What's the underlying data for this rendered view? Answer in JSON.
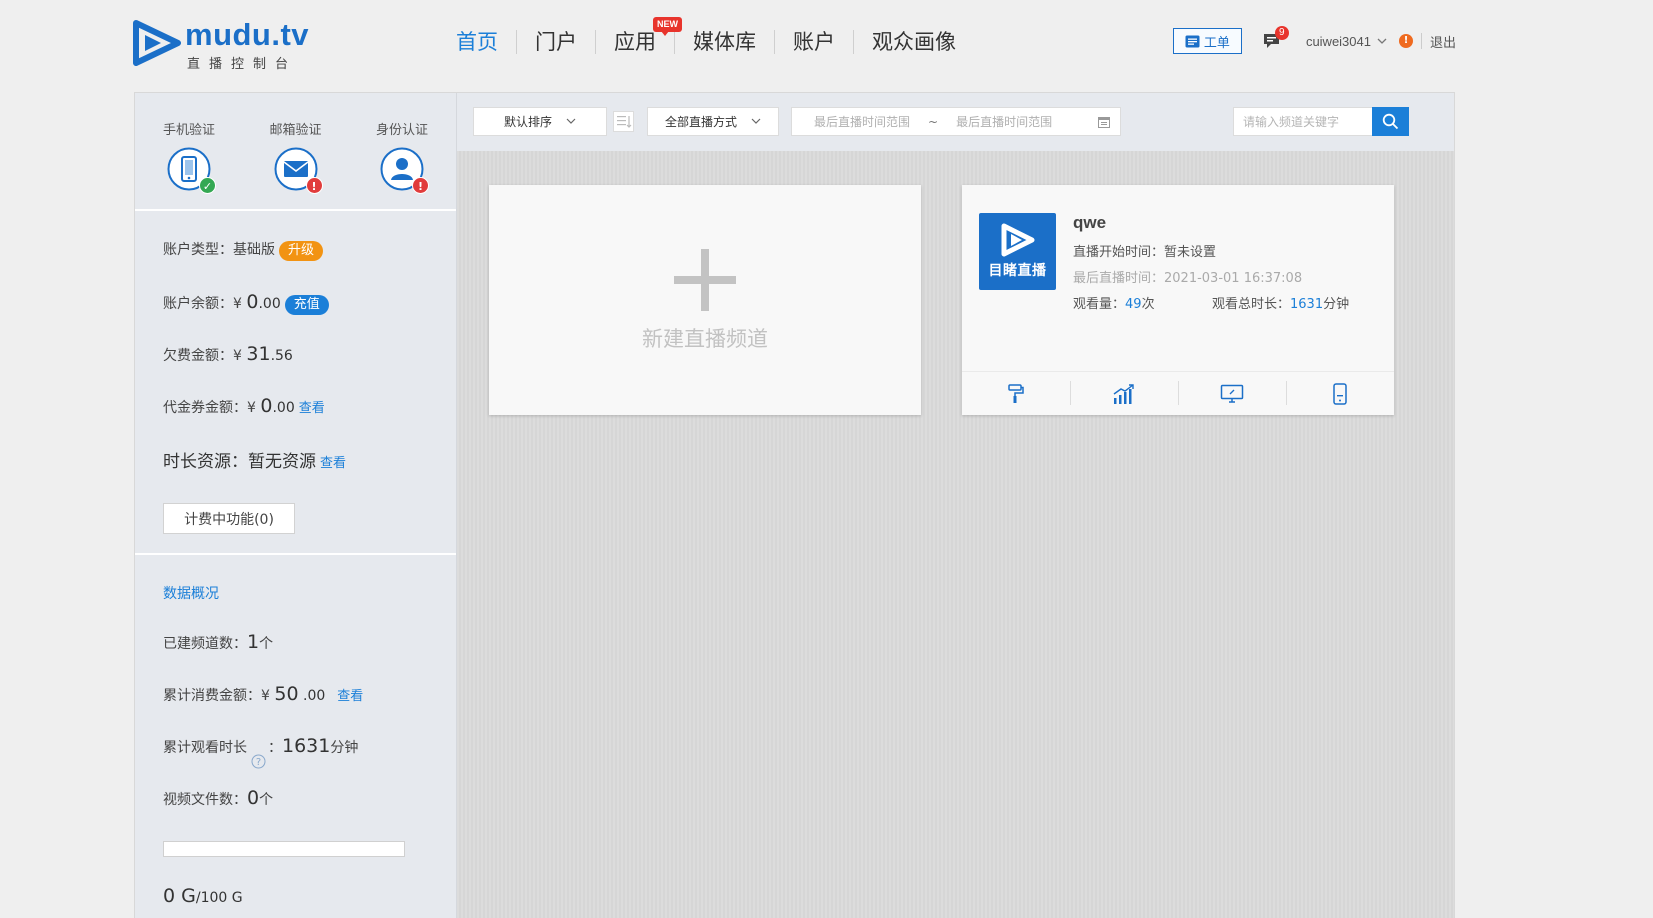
{
  "brand": {
    "name": "mudu.tv",
    "subtitle": "直播控制台"
  },
  "nav": [
    {
      "label": "首页",
      "active": true
    },
    {
      "label": "门户"
    },
    {
      "label": "应用",
      "badge": "NEW"
    },
    {
      "label": "媒体库"
    },
    {
      "label": "账户"
    },
    {
      "label": "观众画像"
    }
  ],
  "header": {
    "ticket_label": "工单",
    "message_count": "9",
    "username": "cuiwei3041",
    "alert_symbol": "!",
    "logout_label": "退出"
  },
  "verify": [
    {
      "label": "手机验证",
      "icon": "phone-icon",
      "status": "ok"
    },
    {
      "label": "邮箱验证",
      "icon": "mail-icon",
      "status": "warn"
    },
    {
      "label": "身份认证",
      "icon": "user-icon",
      "status": "warn"
    }
  ],
  "account": {
    "type_label": "账户类型：",
    "type_value": "基础版",
    "upgrade_label": "升级",
    "balance_label": "账户余额：",
    "currency": "¥",
    "balance_int": "0",
    "balance_dec": ".00",
    "recharge_label": "充值",
    "owed_label": "欠费金额：",
    "owed_int": "31",
    "owed_dec": ".56",
    "voucher_label": "代金券金额：",
    "voucher_int": "0",
    "voucher_dec": ".00",
    "view_label": "查看",
    "time_label": "时长资源：",
    "time_value": "暂无资源",
    "billing_button": "计费中功能(0)"
  },
  "stats": {
    "title": "数据概况",
    "channels_label": "已建频道数：",
    "channels_value": "1",
    "channels_unit": "个",
    "spend_label": "累计消费金额：",
    "spend_int": "50",
    "spend_dec": ".00",
    "watch_label": "累计观看时长",
    "watch_value": "1631",
    "watch_unit": "分钟",
    "video_label": "视频文件数：",
    "video_value": "0",
    "video_unit": "个",
    "storage_used": "0 G",
    "storage_total": "/100 G",
    "storage_fraction": 0
  },
  "toolbar": {
    "sort_value": "默认排序",
    "mode_value": "全部直播方式",
    "date_start_placeholder": "最后直播时间范围",
    "date_sep": "~",
    "date_end_placeholder": "最后直播时间范围",
    "search_placeholder": "请输入频道关键字"
  },
  "new_channel_label": "新建直播频道",
  "channel": {
    "name": "qwe",
    "thumb_text": "目睹直播",
    "start_label": "直播开始时间：",
    "start_value": "暂未设置",
    "last_label": "最后直播时间：",
    "last_value": "2021-03-01 16:37:08",
    "views_label": "观看量：",
    "views_value": "49",
    "views_unit": "次",
    "duration_label": "观看总时长：",
    "duration_value": "1631",
    "duration_unit": "分钟",
    "actions": [
      "paint-roller-icon",
      "chart-icon",
      "monitor-icon",
      "mobile-icon"
    ]
  },
  "colors": {
    "accent": "#1b7fd8",
    "brand": "#1b6fc8",
    "warn": "#e13c3c",
    "ok": "#34a853",
    "orange": "#f29312"
  }
}
